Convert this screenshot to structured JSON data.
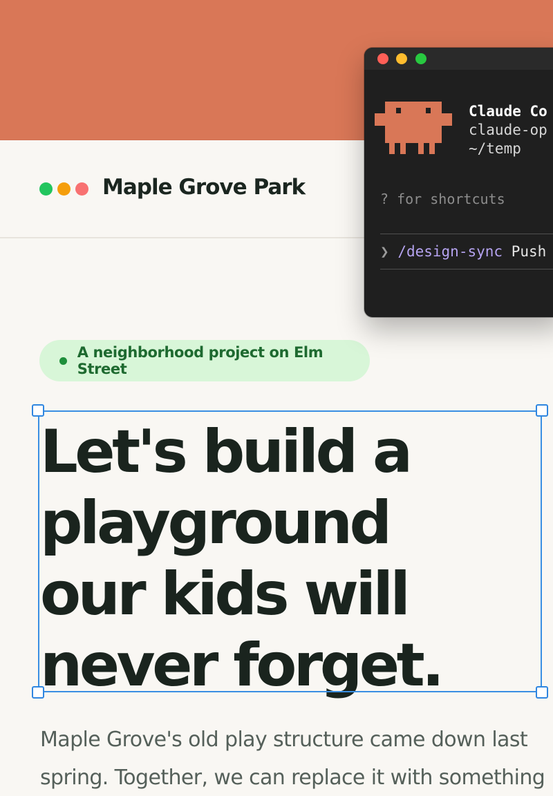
{
  "colors": {
    "backdrop": "#d97757",
    "page_bg": "#f9f7f3",
    "accent_green": "#1f8f3c",
    "selection_blue": "#2f86e0",
    "terminal_bg": "#1f1f1f",
    "mascot": "#d97757"
  },
  "site": {
    "logo_dots": [
      "#22c55e",
      "#f59e0b",
      "#f87171"
    ],
    "title": "Maple Grove Park"
  },
  "hero": {
    "badge_text": "A neighborhood project on Elm Street",
    "headline_lines": [
      "Let's build a",
      "playground",
      "our kids will",
      "never forget."
    ],
    "body_lines": [
      "Maple Grove's old play structure came down last",
      "spring. Together, we can replace it with something"
    ]
  },
  "terminal": {
    "traffic_lights": [
      "#ff5f57",
      "#febc2e",
      "#28c840"
    ],
    "title": "Claude Co",
    "subtitle": "claude-op",
    "path": "~/temp",
    "hint": "? for shortcuts",
    "prompt_symbol": "❯",
    "command": "/design-sync",
    "command_rest": "Push"
  }
}
